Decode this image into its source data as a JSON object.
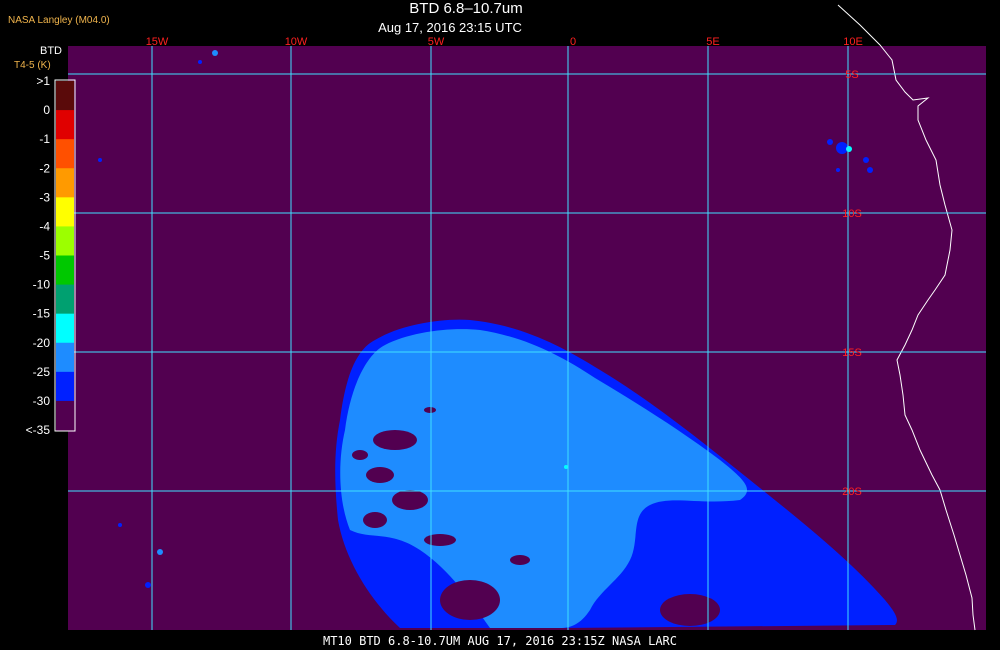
{
  "header": {
    "source": "NASA Langley (M04.0)",
    "title": "BTD 6.8–10.7um",
    "subtitle": "Aug 17, 2016 23:15 UTC"
  },
  "footer": {
    "text": "MT10  BTD 6.8-10.7UM  AUG 17, 2016 23:15Z  NASA LARC"
  },
  "colorbar": {
    "title_line1": "BTD",
    "title_line2": "T4-5 (K)",
    "labels": [
      ">1",
      "0",
      "-1",
      "-2",
      "-3",
      "-4",
      "-5",
      "-10",
      "-15",
      "-20",
      "-25",
      "-30",
      "<-35"
    ],
    "colors": [
      "#5a0a0a",
      "#e00000",
      "#ff5000",
      "#ff9a00",
      "#ffff00",
      "#9cff00",
      "#00c800",
      "#00a070",
      "#00ffff",
      "#1e8cff",
      "#0020ff",
      "#520050"
    ]
  },
  "map": {
    "lon_labels": [
      "15W",
      "10W",
      "5W",
      "0",
      "5E",
      "10E"
    ],
    "lat_labels": [
      "5S",
      "10S",
      "15S",
      "20S"
    ],
    "colors": {
      "background": "#520050",
      "grid": "#40e0ff",
      "coast": "#ffffff",
      "cloud_edge": "#0020ff",
      "cloud_core": "#1e8cff",
      "hole": "#520050",
      "lat_label": "#ff2020",
      "lon_label": "#ff2020"
    }
  }
}
